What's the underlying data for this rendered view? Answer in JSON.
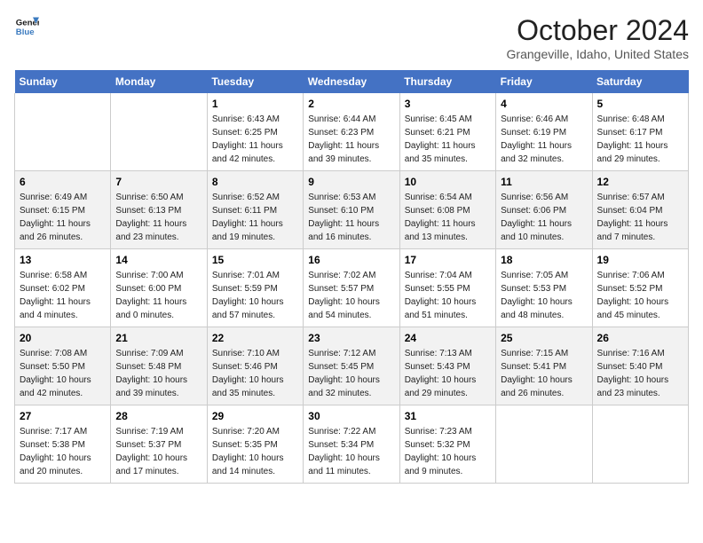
{
  "header": {
    "logo_line1": "General",
    "logo_line2": "Blue",
    "month": "October 2024",
    "location": "Grangeville, Idaho, United States"
  },
  "weekdays": [
    "Sunday",
    "Monday",
    "Tuesday",
    "Wednesday",
    "Thursday",
    "Friday",
    "Saturday"
  ],
  "weeks": [
    [
      {
        "day": "",
        "info": ""
      },
      {
        "day": "",
        "info": ""
      },
      {
        "day": "1",
        "info": "Sunrise: 6:43 AM\nSunset: 6:25 PM\nDaylight: 11 hours\nand 42 minutes."
      },
      {
        "day": "2",
        "info": "Sunrise: 6:44 AM\nSunset: 6:23 PM\nDaylight: 11 hours\nand 39 minutes."
      },
      {
        "day": "3",
        "info": "Sunrise: 6:45 AM\nSunset: 6:21 PM\nDaylight: 11 hours\nand 35 minutes."
      },
      {
        "day": "4",
        "info": "Sunrise: 6:46 AM\nSunset: 6:19 PM\nDaylight: 11 hours\nand 32 minutes."
      },
      {
        "day": "5",
        "info": "Sunrise: 6:48 AM\nSunset: 6:17 PM\nDaylight: 11 hours\nand 29 minutes."
      }
    ],
    [
      {
        "day": "6",
        "info": "Sunrise: 6:49 AM\nSunset: 6:15 PM\nDaylight: 11 hours\nand 26 minutes."
      },
      {
        "day": "7",
        "info": "Sunrise: 6:50 AM\nSunset: 6:13 PM\nDaylight: 11 hours\nand 23 minutes."
      },
      {
        "day": "8",
        "info": "Sunrise: 6:52 AM\nSunset: 6:11 PM\nDaylight: 11 hours\nand 19 minutes."
      },
      {
        "day": "9",
        "info": "Sunrise: 6:53 AM\nSunset: 6:10 PM\nDaylight: 11 hours\nand 16 minutes."
      },
      {
        "day": "10",
        "info": "Sunrise: 6:54 AM\nSunset: 6:08 PM\nDaylight: 11 hours\nand 13 minutes."
      },
      {
        "day": "11",
        "info": "Sunrise: 6:56 AM\nSunset: 6:06 PM\nDaylight: 11 hours\nand 10 minutes."
      },
      {
        "day": "12",
        "info": "Sunrise: 6:57 AM\nSunset: 6:04 PM\nDaylight: 11 hours\nand 7 minutes."
      }
    ],
    [
      {
        "day": "13",
        "info": "Sunrise: 6:58 AM\nSunset: 6:02 PM\nDaylight: 11 hours\nand 4 minutes."
      },
      {
        "day": "14",
        "info": "Sunrise: 7:00 AM\nSunset: 6:00 PM\nDaylight: 11 hours\nand 0 minutes."
      },
      {
        "day": "15",
        "info": "Sunrise: 7:01 AM\nSunset: 5:59 PM\nDaylight: 10 hours\nand 57 minutes."
      },
      {
        "day": "16",
        "info": "Sunrise: 7:02 AM\nSunset: 5:57 PM\nDaylight: 10 hours\nand 54 minutes."
      },
      {
        "day": "17",
        "info": "Sunrise: 7:04 AM\nSunset: 5:55 PM\nDaylight: 10 hours\nand 51 minutes."
      },
      {
        "day": "18",
        "info": "Sunrise: 7:05 AM\nSunset: 5:53 PM\nDaylight: 10 hours\nand 48 minutes."
      },
      {
        "day": "19",
        "info": "Sunrise: 7:06 AM\nSunset: 5:52 PM\nDaylight: 10 hours\nand 45 minutes."
      }
    ],
    [
      {
        "day": "20",
        "info": "Sunrise: 7:08 AM\nSunset: 5:50 PM\nDaylight: 10 hours\nand 42 minutes."
      },
      {
        "day": "21",
        "info": "Sunrise: 7:09 AM\nSunset: 5:48 PM\nDaylight: 10 hours\nand 39 minutes."
      },
      {
        "day": "22",
        "info": "Sunrise: 7:10 AM\nSunset: 5:46 PM\nDaylight: 10 hours\nand 35 minutes."
      },
      {
        "day": "23",
        "info": "Sunrise: 7:12 AM\nSunset: 5:45 PM\nDaylight: 10 hours\nand 32 minutes."
      },
      {
        "day": "24",
        "info": "Sunrise: 7:13 AM\nSunset: 5:43 PM\nDaylight: 10 hours\nand 29 minutes."
      },
      {
        "day": "25",
        "info": "Sunrise: 7:15 AM\nSunset: 5:41 PM\nDaylight: 10 hours\nand 26 minutes."
      },
      {
        "day": "26",
        "info": "Sunrise: 7:16 AM\nSunset: 5:40 PM\nDaylight: 10 hours\nand 23 minutes."
      }
    ],
    [
      {
        "day": "27",
        "info": "Sunrise: 7:17 AM\nSunset: 5:38 PM\nDaylight: 10 hours\nand 20 minutes."
      },
      {
        "day": "28",
        "info": "Sunrise: 7:19 AM\nSunset: 5:37 PM\nDaylight: 10 hours\nand 17 minutes."
      },
      {
        "day": "29",
        "info": "Sunrise: 7:20 AM\nSunset: 5:35 PM\nDaylight: 10 hours\nand 14 minutes."
      },
      {
        "day": "30",
        "info": "Sunrise: 7:22 AM\nSunset: 5:34 PM\nDaylight: 10 hours\nand 11 minutes."
      },
      {
        "day": "31",
        "info": "Sunrise: 7:23 AM\nSunset: 5:32 PM\nDaylight: 10 hours\nand 9 minutes."
      },
      {
        "day": "",
        "info": ""
      },
      {
        "day": "",
        "info": ""
      }
    ]
  ]
}
